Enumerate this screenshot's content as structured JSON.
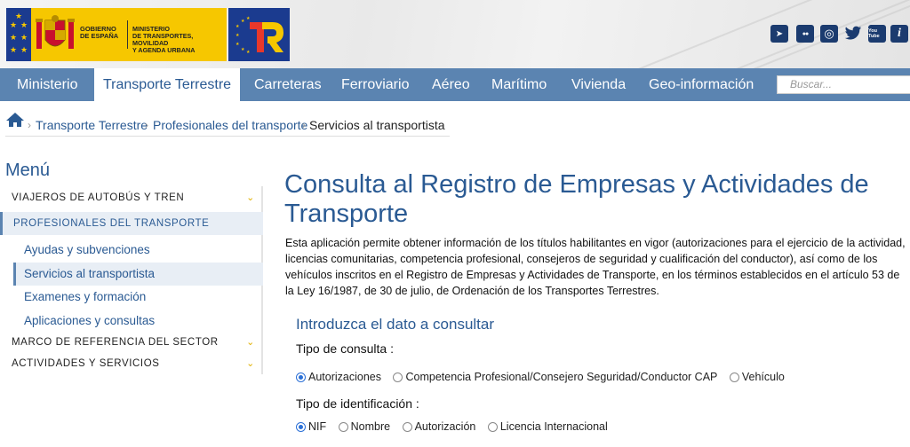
{
  "header": {
    "gobierno_text": [
      "GOBIERNO",
      "DE ESPAÑA"
    ],
    "ministerio_text": [
      "MINISTERIO",
      "DE TRANSPORTES, MOVILIDAD",
      "Y AGENDA URBANA"
    ],
    "tr_logo": "TR",
    "social_icons": [
      "telegram-icon",
      "flickr-icon",
      "instagram-icon",
      "twitter-icon",
      "youtube-icon",
      "info-icon"
    ],
    "social_glyphs": [
      "➤",
      "●●",
      "◎",
      "🐦",
      "You Tube",
      "i"
    ]
  },
  "nav": {
    "items": [
      "Ministerio",
      "Transporte Terrestre",
      "Carreteras",
      "Ferroviario",
      "Aéreo",
      "Marítimo",
      "Vivienda",
      "Geo-información"
    ],
    "active": "Transporte Terrestre",
    "search_placeholder": "Buscar..."
  },
  "breadcrumb": [
    "Transporte Terrestre",
    "Profesionales del transporte",
    "Servicios al transportista"
  ],
  "sidebar": {
    "title": "Menú",
    "sections": [
      {
        "label": "VIAJEROS DE AUTOBÚS Y TREN"
      },
      {
        "label": "PROFESIONALES DEL TRANSPORTE"
      },
      {
        "label": "MARCO DE REFERENCIA DEL SECTOR"
      },
      {
        "label": "ACTIVIDADES Y SERVICIOS"
      }
    ],
    "subitems": [
      "Ayudas y subvenciones",
      "Servicios al transportista",
      "Examenes y formación",
      "Aplicaciones y consultas"
    ]
  },
  "main": {
    "title": "Consulta al Registro de Empresas y Actividades de Transporte",
    "intro": "Esta aplicación permite obtener información de los títulos habilitantes en vigor (autorizaciones para el ejercicio de la actividad, licencias comunitarias, competencia profesional, consejeros de seguridad y cualificación del conductor), así como de los vehículos inscritos en el Registro de Empresas y Actividades de Transporte, en los términos establecidos en el artículo 53 de la Ley 16/1987, de 30 de julio, de Ordenación de los Transportes Terrestres.",
    "form_title": "Introduzca el dato a consultar",
    "tipo_consulta_label": "Tipo de consulta :",
    "tipo_consulta_options": [
      "Autorizaciones",
      "Competencia Profesional/Consejero Seguridad/Conductor CAP",
      "Vehículo"
    ],
    "tipo_identificacion_label": "Tipo de identificación :",
    "tipo_identificacion_options": [
      "NIF",
      "Nombre",
      "Autorización",
      "Licencia Internacional"
    ]
  },
  "colors": {
    "nav_bg": "#5b84b1",
    "link": "#2a5a93",
    "gov_yellow": "#f6c700",
    "gov_blue": "#1b3b8f",
    "accent_chevron": "#e0b000"
  }
}
